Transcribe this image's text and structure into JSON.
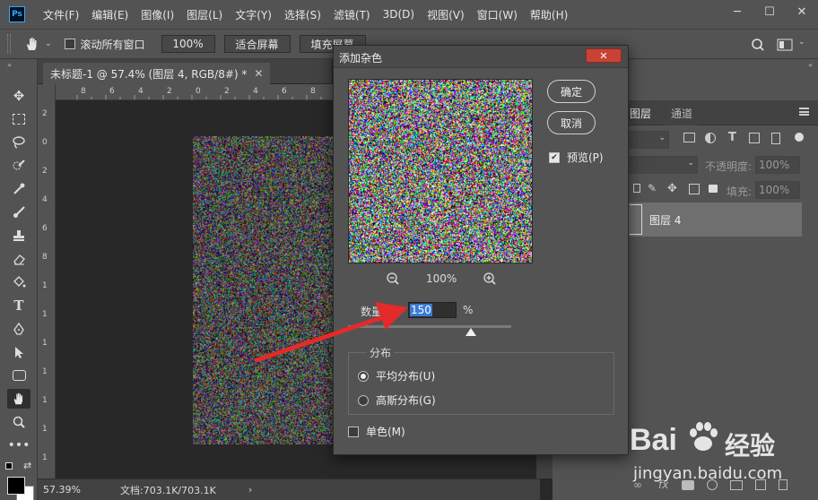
{
  "app": {
    "logo": "Ps"
  },
  "menu": [
    "文件(F)",
    "编辑(E)",
    "图像(I)",
    "图层(L)",
    "文字(Y)",
    "选择(S)",
    "滤镜(T)",
    "3D(D)",
    "视图(V)",
    "窗口(W)",
    "帮助(H)"
  ],
  "window_controls": {
    "minimize": "─",
    "restore": "☐",
    "close": "✕"
  },
  "options_bar": {
    "scroll_all_label": "滚动所有窗口",
    "zoom_value": "100%",
    "fit_screen_label": "适合屏幕",
    "fill_screen_label": "填充屏幕"
  },
  "document": {
    "tab_title": "未标题-1 @ 57.4% (图层 4, RGB/8#) *"
  },
  "ruler": {
    "h_ticks": [
      "8",
      "6",
      "4",
      "2",
      "0",
      "2",
      "4",
      "6",
      "8"
    ],
    "v_ticks": [
      "2",
      "0",
      "2",
      "4",
      "6",
      "8",
      "1",
      "1",
      "1",
      "1",
      "1",
      "1",
      "1"
    ]
  },
  "status": {
    "zoom": "57.39%",
    "doc_size": "文档:703.1K/703.1K"
  },
  "layers_panel": {
    "tabs": [
      "图层",
      "通道"
    ],
    "opacity_label": "不透明度:",
    "opacity_value": "100%",
    "fill_label": "填充:",
    "fill_value": "100%",
    "layer_name": "图层 4"
  },
  "dialog": {
    "title": "添加杂色",
    "close_icon": "✕",
    "ok_label": "确定",
    "cancel_label": "取消",
    "preview_label": "预览(P)",
    "preview_checked": true,
    "zoom_value": "100%",
    "amount_label": "数量(A):",
    "amount_value": "150",
    "amount_unit": "%",
    "amount_percent": 150,
    "distribution_label": "分布",
    "uniform_label": "平均分布(U)",
    "gaussian_label": "高斯分布(G)",
    "uniform_selected": true,
    "mono_label": "单色(M)",
    "mono_checked": false
  },
  "watermark": {
    "brand_a": "Bai",
    "brand_b": "经验",
    "url": "jingyan.baidu.com"
  },
  "colors": {
    "accent_blue": "#3a7bd5",
    "close_red": "#c94236",
    "arrow_red": "#e42a2a",
    "ps_blue": "#31a8ff"
  }
}
